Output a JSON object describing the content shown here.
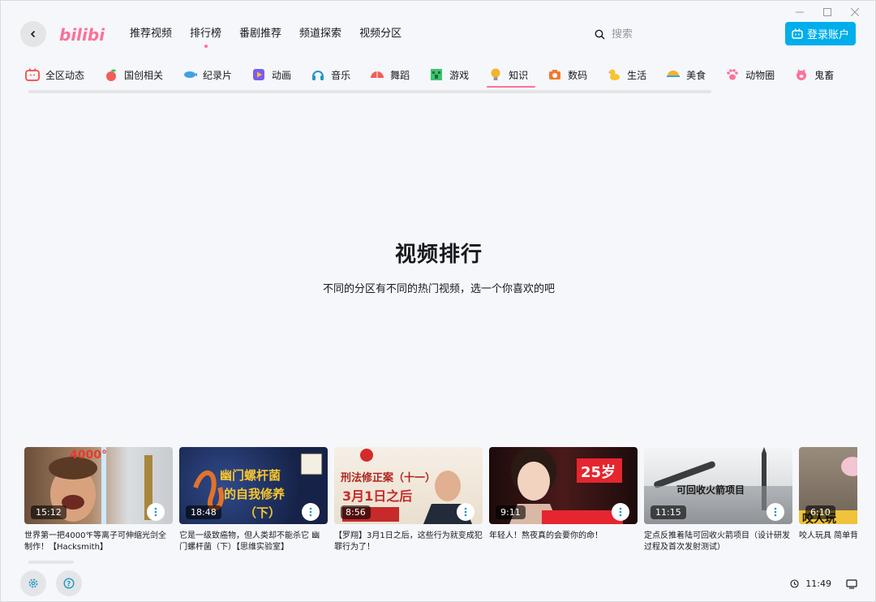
{
  "window": {
    "controls": [
      {
        "name": "minimize-icon"
      },
      {
        "name": "maximize-icon"
      },
      {
        "name": "close-icon"
      }
    ]
  },
  "header": {
    "logo_text": "bilibili",
    "nav": [
      {
        "label": "推荐视频"
      },
      {
        "label": "排行榜",
        "active": true
      },
      {
        "label": "番剧推荐"
      },
      {
        "label": "频道探索"
      },
      {
        "label": "视频分区"
      }
    ],
    "search_placeholder": "搜索",
    "login_label": "登录账户"
  },
  "categories": [
    {
      "label": "全区动态",
      "icon": "tv-icon",
      "color": "#fb7299"
    },
    {
      "label": "国创相关",
      "icon": "peach-icon",
      "color": "#f25d59"
    },
    {
      "label": "纪录片",
      "icon": "fish-icon",
      "color": "#3fa3e0"
    },
    {
      "label": "动画",
      "icon": "play-icon",
      "color": "#7b5cf0"
    },
    {
      "label": "音乐",
      "icon": "headphones-icon",
      "color": "#2196c9"
    },
    {
      "label": "舞蹈",
      "icon": "fan-icon",
      "color": "#f25d59"
    },
    {
      "label": "游戏",
      "icon": "creeper-icon",
      "color": "#3cc46e"
    },
    {
      "label": "知识",
      "icon": "lightbulb-icon",
      "color": "#f5b32a",
      "active": true
    },
    {
      "label": "数码",
      "icon": "camera-icon",
      "color": "#f27a2a"
    },
    {
      "label": "生活",
      "icon": "duck-icon",
      "color": "#f5c530"
    },
    {
      "label": "美食",
      "icon": "dish-icon",
      "color": "#f5b32a"
    },
    {
      "label": "动物圈",
      "icon": "paw-icon",
      "color": "#fb7299"
    },
    {
      "label": "鬼畜",
      "icon": "pig-icon",
      "color": "#fb7299"
    }
  ],
  "hero": {
    "title": "视频排行",
    "subtitle": "不同的分区有不同的热门视频，选一个你喜欢的吧"
  },
  "videos": [
    {
      "duration": "15:12",
      "title": "世界第一把4000℉等离子可伸缩光剑全制作！【Hacksmith】",
      "thumb_text": "4000°",
      "bg": "#7f5d46"
    },
    {
      "duration": "18:48",
      "title": "它是一级致癌物，但人类却不能杀它 幽门螺杆菌（下）【思维实验室】",
      "thumb_text": "幽门螺杆菌 的自我修养 （下）",
      "bg": "#1b2a55"
    },
    {
      "duration": "8:56",
      "title": "【罗翔】3月1日之后，这些行为就变成犯罪行为了！",
      "thumb_text": "刑法修正案（十一） 3月1日之后",
      "bg": "#f1e7da"
    },
    {
      "duration": "9:11",
      "title": "年轻人！熬夜真的会要你的命！",
      "thumb_text": "25岁",
      "bg": "#2b1010"
    },
    {
      "duration": "11:15",
      "title": "定点反推着陆可回收火箭项目（设计研发过程及首次发射测试）",
      "thumb_text": "可回收火箭项目",
      "bg": "#a9adb1"
    },
    {
      "duration": "6:10",
      "title": "咬人玩具 简单背后",
      "thumb_text": "咬人玩",
      "bg": "#8a7c6d"
    }
  ],
  "footer": {
    "time": "11:49"
  }
}
